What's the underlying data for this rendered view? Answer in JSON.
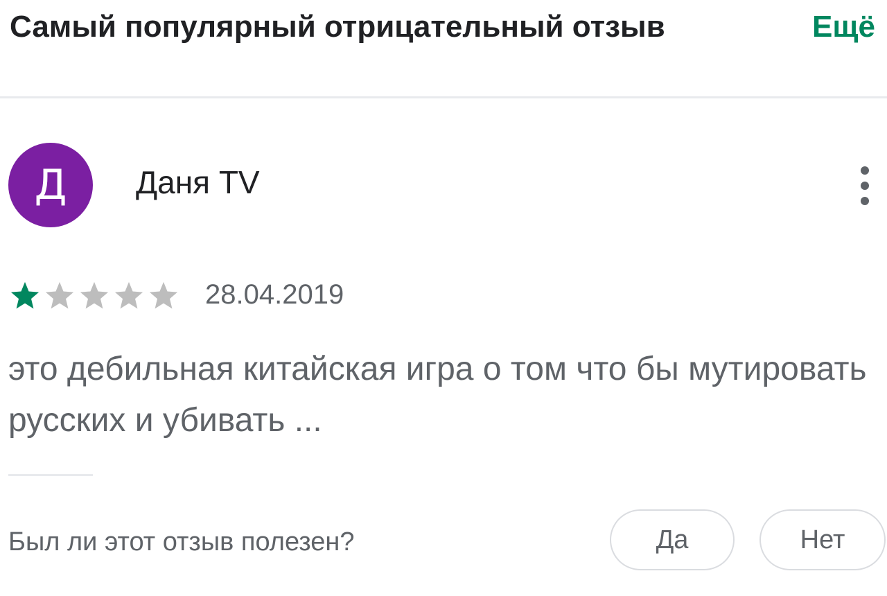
{
  "header": {
    "title": "Самый популярный отрицательный отзыв",
    "more_label": "Ещё"
  },
  "review": {
    "avatar_letter": "Д",
    "avatar_color": "#7b1fa2",
    "author": "Даня TV",
    "rating": 1,
    "rating_max": 5,
    "date": "28.04.2019",
    "text": "это дебильная китайская игра о том что бы мутировать русских и убивать ..."
  },
  "feedback": {
    "question": "Был ли этот отзыв полезен?",
    "yes_label": "Да",
    "no_label": "Нет"
  },
  "colors": {
    "accent": "#01875f",
    "star_filled": "#01875f",
    "star_empty": "#bdbdbd"
  },
  "icons": {
    "menu": "more-vert-icon",
    "star": "star-icon"
  }
}
